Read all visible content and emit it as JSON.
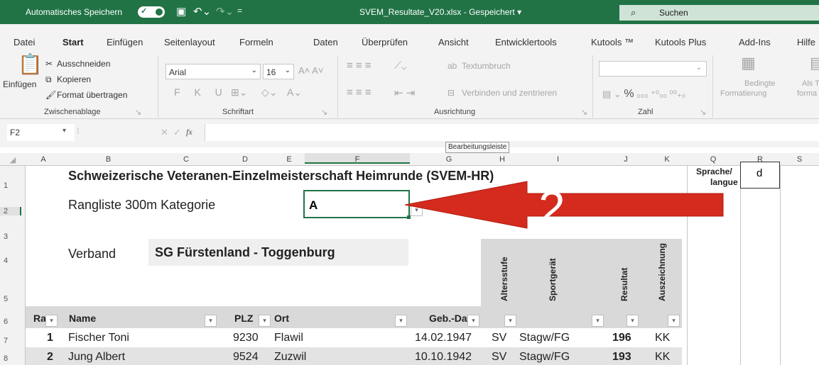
{
  "titlebar": {
    "autosave": "Automatisches Speichern",
    "filename": "SVEM_Resultate_V20.xlsx - Gespeichert ▾",
    "search": "Suchen"
  },
  "menu": [
    "Datei",
    "Start",
    "Einfügen",
    "Seitenlayout",
    "Formeln",
    "Daten",
    "Überprüfen",
    "Ansicht",
    "Entwicklertools",
    "Kutools ™",
    "Kutools Plus",
    "Add-Ins",
    "Hilfe"
  ],
  "ribbon": {
    "paste": "Einfügen",
    "cut": "Ausschneiden",
    "copy": "Kopieren",
    "format_painter": "Format übertragen",
    "clipboard_group": "Zwischenablage",
    "font_name": "Arial",
    "font_size": "16",
    "font_group": "Schriftart",
    "wrap": "Textumbruch",
    "merge": "Verbinden und zentrieren",
    "align_group": "Ausrichtung",
    "number_group": "Zahl",
    "cond_format_1": "Bedingte",
    "cond_format_2": "Formatierung",
    "table_1": "Als T",
    "table_2": "forma"
  },
  "namebox": "F2",
  "tooltip": "Bearbeitungsleiste",
  "columns": [
    "A",
    "B",
    "C",
    "D",
    "E",
    "F",
    "G",
    "H",
    "I",
    "J",
    "K",
    "Q",
    "R",
    "S"
  ],
  "rows": [
    "1",
    "2",
    "3",
    "4",
    "5",
    "6",
    "7",
    "8"
  ],
  "sheet": {
    "title": "Schweizerische Veteranen-Einzelmeisterschaft Heimrunde (SVEM-HR)",
    "sprache_label_1": "Sprache/",
    "sprache_label_2": "langue",
    "sprache_value": "d",
    "rangliste_label": "Rangliste 300m Kategorie",
    "kategorie_value": "A",
    "verband_label": "Verband",
    "verband_value": "SG Fürstenland - Toggenburg",
    "headers": {
      "rang": "Rai",
      "name": "Name",
      "plz": "PLZ",
      "ort": "Ort",
      "geb": "Geb.-Dat",
      "altersstufe": "Altersstufe",
      "sportgeraet": "Sportgerät",
      "resultat": "Resultat",
      "auszeichnung": "Auszeichnung"
    },
    "data_rows": [
      {
        "rang": "1",
        "name": "Fischer Toni",
        "plz": "9230",
        "ort": "Flawil",
        "geb": "14.02.1947",
        "stufe": "SV",
        "geraet": "Stagw/FG",
        "resultat": "196",
        "ausz": "KK"
      },
      {
        "rang": "2",
        "name": "Jung Albert",
        "plz": "9524",
        "ort": "Zuzwil",
        "geb": "10.10.1942",
        "stufe": "SV",
        "geraet": "Stagw/FG",
        "resultat": "193",
        "ausz": "KK"
      }
    ]
  },
  "arrow_label": "2",
  "colors": {
    "excel_green": "#217346",
    "arrow_red": "#d42b1e",
    "header_gray": "#d9d9d9"
  }
}
